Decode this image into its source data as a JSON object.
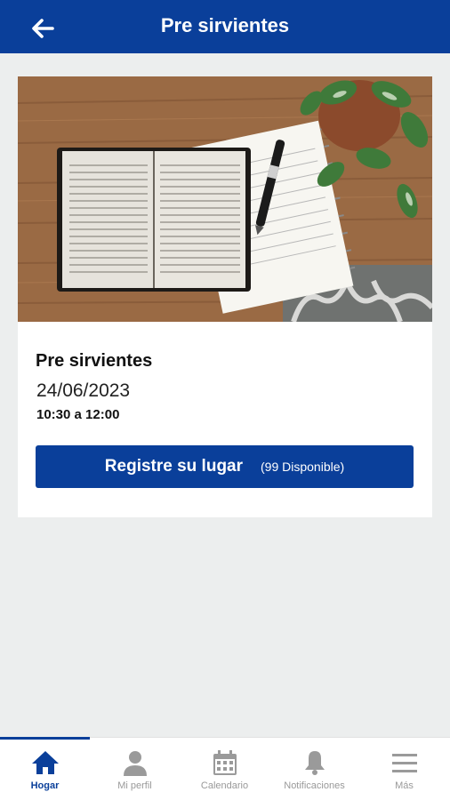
{
  "header": {
    "title": "Pre sirvientes",
    "back_icon": "arrow-left-icon"
  },
  "event": {
    "image": "open-bible-notebook-plant-photo",
    "title": "Pre sirvientes",
    "date": "24/06/2023",
    "time": "10:30 a 12:00",
    "register_label": "Registre su lugar",
    "availability": "(99 Disponible)"
  },
  "nav": {
    "items": [
      {
        "label": "Hogar",
        "icon": "home-icon",
        "active": true
      },
      {
        "label": "Mi perfil",
        "icon": "user-icon",
        "active": false
      },
      {
        "label": "Calendario",
        "icon": "calendar-icon",
        "active": false
      },
      {
        "label": "Notificaciones",
        "icon": "bell-icon",
        "active": false
      },
      {
        "label": "Más",
        "icon": "menu-icon",
        "active": false
      }
    ]
  },
  "colors": {
    "primary": "#0a3f9a",
    "background": "#eceeee",
    "inactive": "#999999"
  }
}
